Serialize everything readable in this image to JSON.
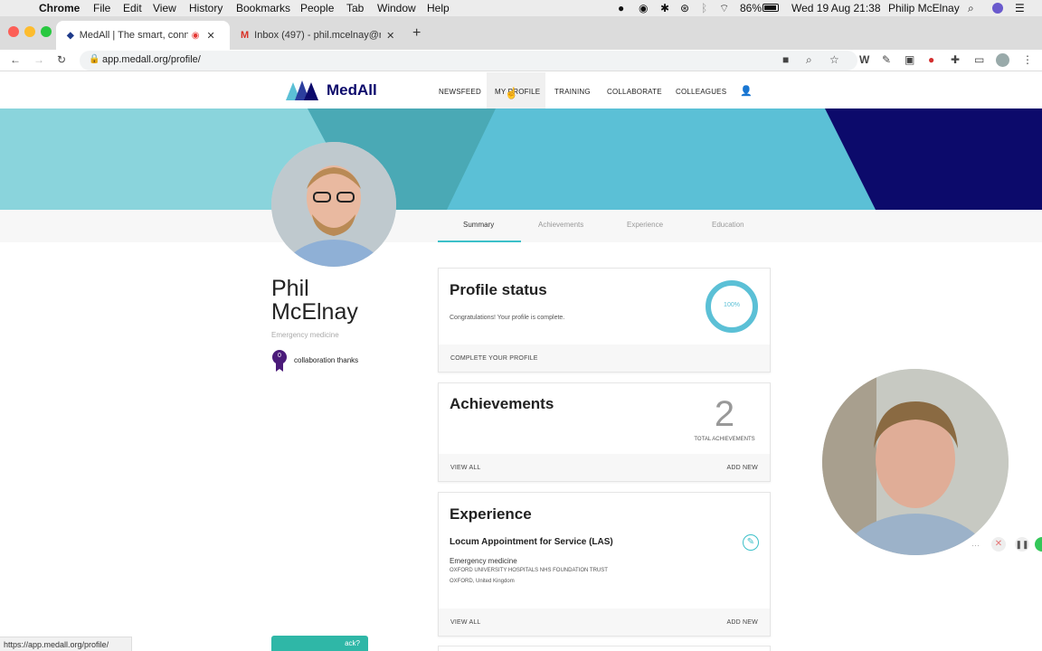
{
  "menubar": {
    "app": "Chrome",
    "items": [
      "File",
      "Edit",
      "View",
      "History",
      "Bookmarks",
      "People",
      "Tab",
      "Window",
      "Help"
    ],
    "battery": "86%",
    "datetime": "Wed 19 Aug  21:38",
    "user": "Philip McElnay"
  },
  "tabs": [
    {
      "title": "MedAll | The smart, connec"
    },
    {
      "title": "Inbox (497) - phil.mcelnay@m"
    }
  ],
  "address": {
    "url": "app.medall.org/profile/"
  },
  "site": {
    "logo": "MedAll",
    "nav": [
      "NEWSFEED",
      "MY PROFILE",
      "TRAINING",
      "COLLABORATE",
      "COLLEAGUES"
    ]
  },
  "profile_tabs": [
    "Summary",
    "Achievements",
    "Experience",
    "Education"
  ],
  "user": {
    "first_name": "Phil",
    "last_name": "McElnay",
    "specialty": "Emergency medicine",
    "badge_count": "0",
    "badge_label": "collaboration thanks"
  },
  "profile_status": {
    "title": "Profile status",
    "message": "Congratulations! Your profile is complete.",
    "percent_label": "100%",
    "percent": 100,
    "action": "COMPLETE YOUR PROFILE"
  },
  "achievements": {
    "title": "Achievements",
    "count": "2",
    "count_label": "TOTAL ACHIEVEMENTS",
    "view_all": "VIEW ALL",
    "add_new": "ADD NEW"
  },
  "experience": {
    "title": "Experience",
    "role": "Locum Appointment for Service (LAS)",
    "specialty": "Emergency medicine",
    "organisation": "OXFORD UNIVERSITY HOSPITALS NHS FOUNDATION TRUST",
    "location": "OXFORD, United Kingdom",
    "view_all": "VIEW ALL",
    "add_new": "ADD NEW"
  },
  "status_bar": {
    "url": "https://app.medall.org/profile/"
  },
  "feedback_button": "ack?",
  "colors": {
    "teal": "#5bc0d6",
    "navy": "#0c0a6b",
    "purple": "#4b1b7a",
    "accent": "#3cc0c9"
  }
}
